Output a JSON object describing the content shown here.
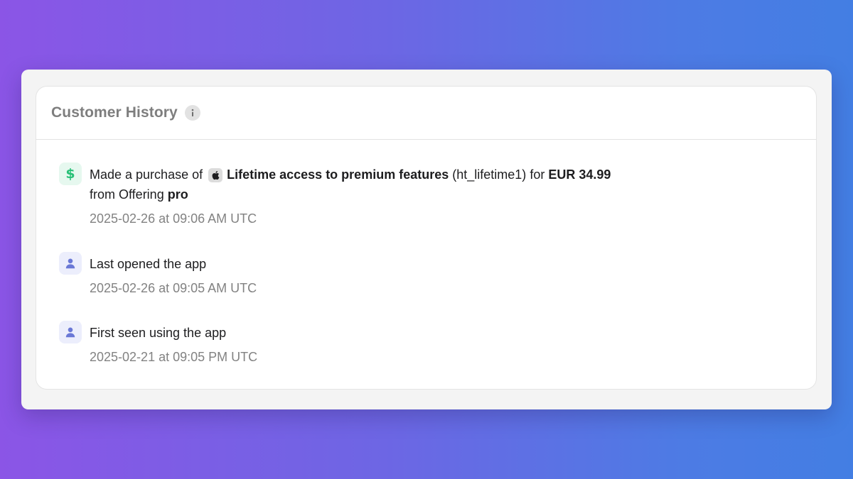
{
  "card": {
    "title": "Customer History",
    "info_icon": "info-icon"
  },
  "events": [
    {
      "icon": "dollar-icon",
      "prefix": "Made a purchase of",
      "store_icon": "apple-icon",
      "product_name": "Lifetime access to premium features",
      "product_id": "(ht_lifetime1)",
      "for_text": "for",
      "price": "EUR 34.99",
      "offering_prefix": "from Offering",
      "offering": "pro",
      "timestamp": "2025-02-26 at 09:06 AM UTC"
    },
    {
      "icon": "user-icon",
      "text": "Last opened the app",
      "timestamp": "2025-02-26 at 09:05 AM UTC"
    },
    {
      "icon": "user-icon",
      "text": "First seen using the app",
      "timestamp": "2025-02-21 at 09:05 PM UTC"
    }
  ],
  "colors": {
    "money_accent": "#28c077",
    "user_accent": "#6a78d6"
  }
}
